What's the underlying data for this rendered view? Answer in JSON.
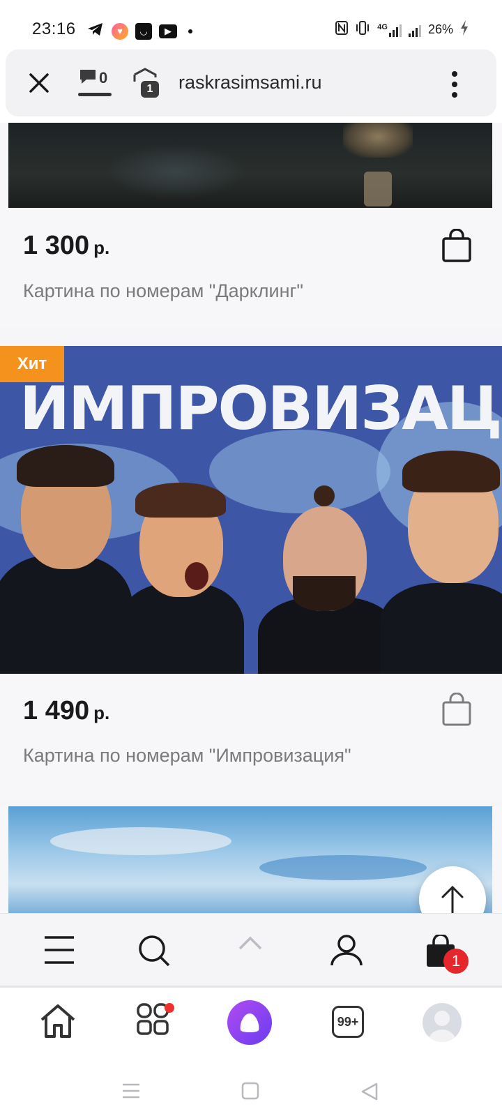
{
  "status_bar": {
    "time": "23:16",
    "battery": "26%",
    "network": "4G",
    "icons_left": [
      "telegram-icon",
      "heart-app-icon",
      "shop-app-icon",
      "youtube-icon",
      "dot-icon"
    ],
    "icons_right": [
      "nfc-icon",
      "vibrate-icon",
      "signal-4g-icon",
      "signal-icon",
      "battery-charging-icon"
    ]
  },
  "browser": {
    "url": "raskrasimsami.ru",
    "comments_count": "0",
    "tabs_count": "1"
  },
  "products": [
    {
      "price": "1 300",
      "currency": "р.",
      "name": "Картина по номерам \"Дарклинг\""
    },
    {
      "badge": "Хит",
      "image_title": "ИМПРОВИЗАЦИЯ",
      "price": "1 490",
      "currency": "р.",
      "name": "Картина по номерам \"Импровизация\""
    }
  ],
  "site_nav": {
    "items": [
      "menu-icon",
      "search-icon",
      "chevron-up-icon",
      "user-icon",
      "shopping-bag-icon"
    ],
    "cart_count": "1"
  },
  "browser_nav": {
    "items": [
      "home-icon",
      "services-icon",
      "alice-icon",
      "tabs-icon",
      "avatar"
    ],
    "tabs_label": "99+"
  },
  "android_nav": {
    "items": [
      "recent-apps-icon",
      "home-square-icon",
      "back-icon"
    ]
  },
  "colors": {
    "badge": "#f5921e",
    "cart_badge": "#e5262b",
    "alice_gradient_start": "#b04cf0",
    "alice_gradient_end": "#6a3cf0"
  }
}
